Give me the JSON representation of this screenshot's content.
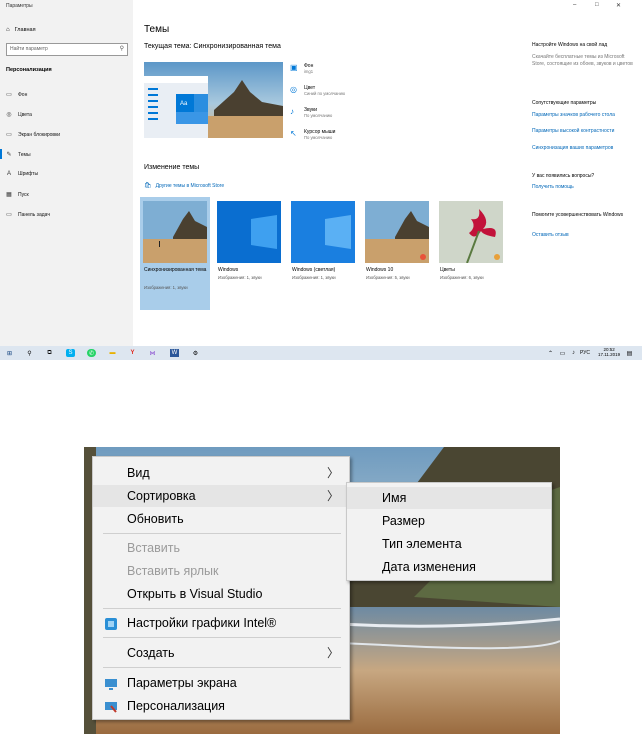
{
  "window": {
    "title": "Параметры",
    "controls": [
      "–",
      "□",
      "✕"
    ]
  },
  "sidebar": {
    "home": "Главная",
    "search_placeholder": "Найти параметр",
    "section": "Персонализация",
    "items": [
      {
        "label": "Фон",
        "icon": "picture-icon"
      },
      {
        "label": "Цвета",
        "icon": "palette-icon"
      },
      {
        "label": "Экран блокировки",
        "icon": "lock-screen-icon"
      },
      {
        "label": "Темы",
        "icon": "brush-icon",
        "active": true
      },
      {
        "label": "Шрифты",
        "icon": "font-icon"
      },
      {
        "label": "Пуск",
        "icon": "start-icon"
      },
      {
        "label": "Панель задач",
        "icon": "taskbar-icon"
      }
    ]
  },
  "main": {
    "title": "Темы",
    "current_theme": "Текущая тема: Синхронизированная тема",
    "properties": [
      {
        "label": "Фон",
        "value": "img1",
        "icon": "picture-icon"
      },
      {
        "label": "Цвет",
        "value": "Синий по умолчанию",
        "icon": "palette-icon"
      },
      {
        "label": "Звуки",
        "value": "По умолчанию",
        "icon": "speaker-icon"
      },
      {
        "label": "Курсор мыши",
        "value": "По умолчанию",
        "icon": "cursor-icon"
      }
    ],
    "change_theme": "Изменение темы",
    "store_link": "Другие темы в Microsoft Store",
    "themes": [
      {
        "name": "Синхронизированная тема",
        "sub": "Изображения: 1, звуки",
        "selected": true
      },
      {
        "name": "Windows",
        "sub": "Изображения: 1, звуки"
      },
      {
        "name": "Windows (светлая)",
        "sub": "Изображения: 1, звуки"
      },
      {
        "name": "Windows 10",
        "sub": "Изображения: 5, звуки"
      },
      {
        "name": "Цветы",
        "sub": "Изображения: 6, звуки"
      }
    ]
  },
  "right_panel": {
    "store_title": "Настройте Windows на свой лад",
    "store_text": "Скачайте бесплатные темы из Microsoft Store, состоящие из обоев, звуков и цветов",
    "related_title": "Сопутствующие параметры",
    "related_links": [
      "Параметры значков рабочего стола",
      "Параметры высокой контрастности",
      "Синхронизация ваших параметров"
    ],
    "question_title": "У вас появились вопросы?",
    "question_link": "Получить помощь",
    "improve_title": "Помогите усовершенствовать Windows",
    "improve_link": "Оставить отзыв"
  },
  "taskbar": {
    "tray_lang": "РУС",
    "time": "20:52",
    "date": "17.11.2019"
  },
  "context_menu": {
    "items": [
      {
        "label": "Вид",
        "submenu": true
      },
      {
        "label": "Сортировка",
        "submenu": true,
        "highlight": true
      },
      {
        "label": "Обновить"
      },
      {
        "label": "Вставить",
        "disabled": true
      },
      {
        "label": "Вставить ярлык",
        "disabled": true
      },
      {
        "label": "Открыть в Visual Studio"
      },
      {
        "label": "Настройки графики Intel®",
        "icon": "intel-graphics-icon"
      },
      {
        "label": "Создать",
        "submenu": true
      },
      {
        "label": "Параметры экрана",
        "icon": "display-icon"
      },
      {
        "label": "Персонализация",
        "icon": "personalize-icon"
      }
    ],
    "submenu": [
      "Имя",
      "Размер",
      "Тип элемента",
      "Дата изменения"
    ]
  },
  "colors": {
    "accent": "#0078d7",
    "link": "#0067b8",
    "selection": "#a9cdea"
  }
}
